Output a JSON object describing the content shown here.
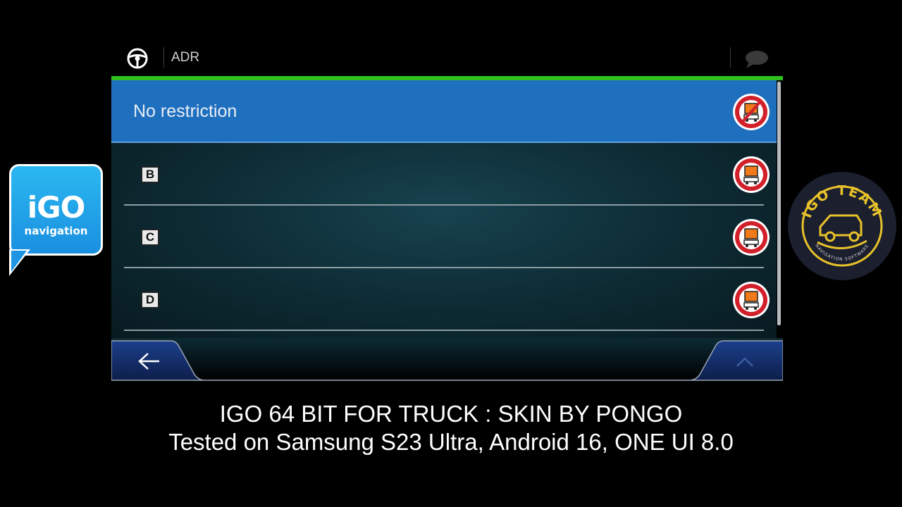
{
  "logos": {
    "left_big": "iGO",
    "left_small": "navigation",
    "right_text": "IGO TEAM",
    "right_subtext": "NAVIGATION SOFTWARE"
  },
  "header": {
    "title": "ADR",
    "steering_icon": "steering-wheel-icon",
    "chat_icon": "chat-bubble-icon"
  },
  "list": {
    "items": [
      {
        "label": "No restriction",
        "selected": true,
        "icon": "no-hazmat-sign-icon"
      },
      {
        "label": "B",
        "selected": false,
        "icon": "hazmat-sign-icon"
      },
      {
        "label": "C",
        "selected": false,
        "icon": "hazmat-sign-icon"
      },
      {
        "label": "D",
        "selected": false,
        "icon": "hazmat-sign-icon"
      }
    ]
  },
  "footer": {
    "back_icon": "arrow-left-icon",
    "up_icon": "chevron-up-icon"
  },
  "caption": {
    "line1": "IGO 64 BIT FOR TRUCK : SKIN BY PONGO",
    "line2": "Tested on Samsung S23 Ultra, Android 16, ONE UI 8.0"
  },
  "colors": {
    "accent_green": "#2fc21f",
    "selected_blue": "#1f6fbf",
    "sign_red": "#d2202a",
    "sign_orange": "#f07a1a"
  }
}
